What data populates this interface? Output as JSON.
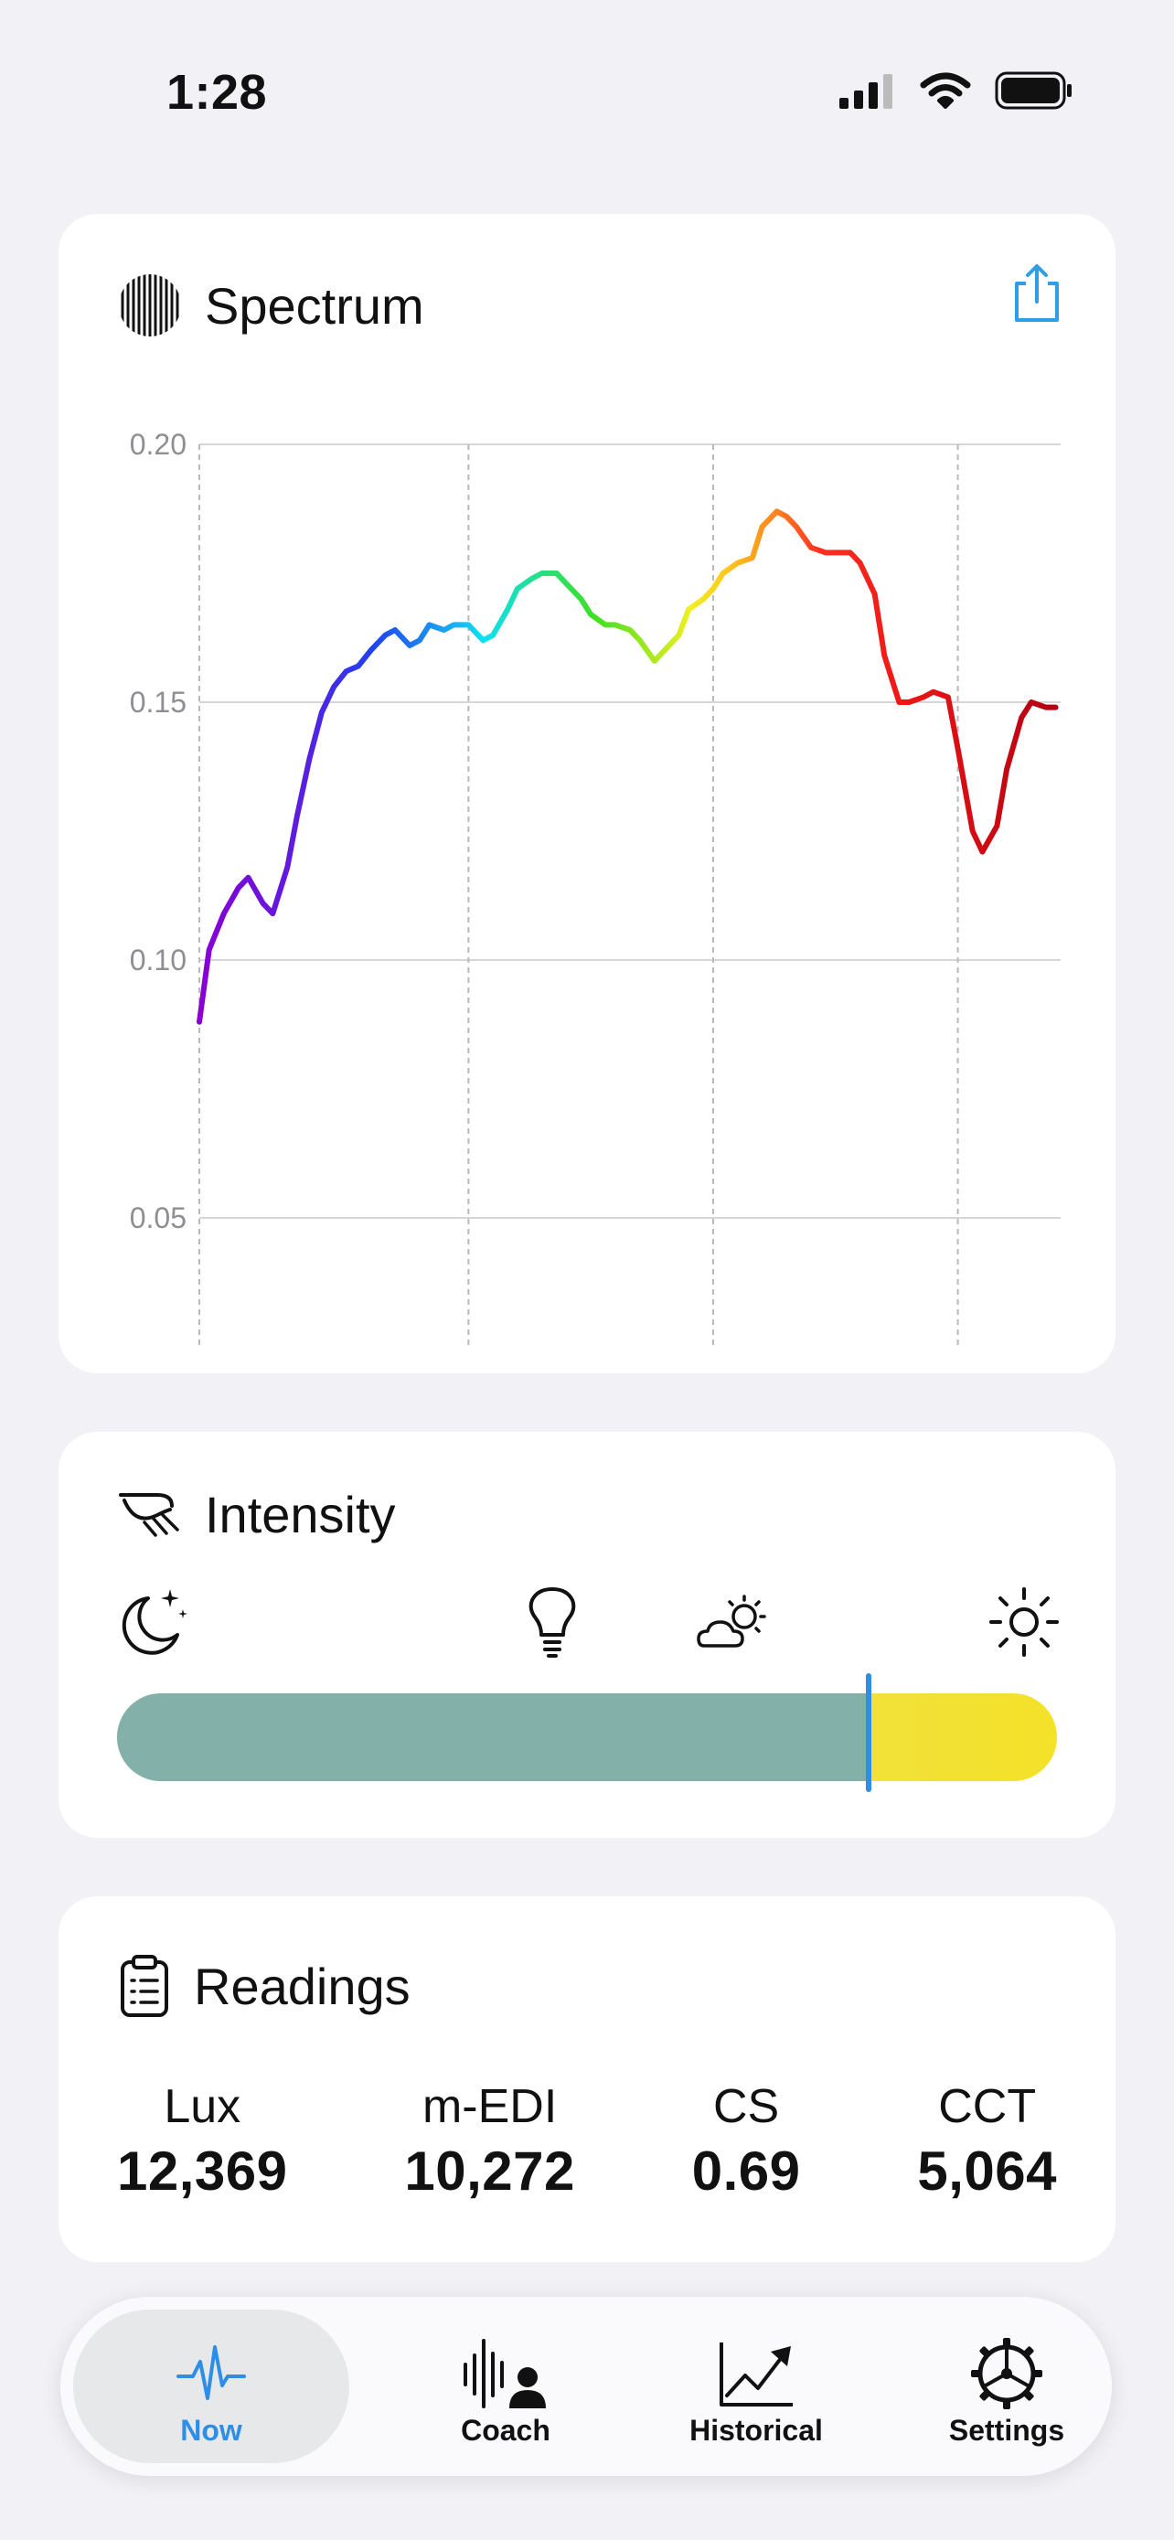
{
  "status_bar": {
    "time": "1:28"
  },
  "spectrum": {
    "title": "Spectrum",
    "icon": "striped-circle-icon",
    "share_icon": "share-icon"
  },
  "chart_data": {
    "type": "line",
    "title": "Spectrum",
    "xlabel": "",
    "ylabel": "",
    "xlim": [
      390,
      742
    ],
    "ylim": [
      0,
      0.2
    ],
    "x_ticks": [
      "400",
      "500",
      "600",
      "700"
    ],
    "y_ticks": [
      "0",
      "0.05",
      "0.10",
      "0.15",
      "0.20"
    ],
    "grid": true,
    "series": [
      {
        "x": [
          390,
          394,
          400,
          406,
          410,
          416,
          420,
          426,
          430,
          435,
          440,
          445,
          450,
          455,
          460,
          466,
          470,
          476,
          480,
          484,
          490,
          494,
          500,
          506,
          510,
          516,
          520,
          526,
          530,
          536,
          540,
          546,
          550,
          556,
          560,
          566,
          570,
          576,
          580,
          586,
          590,
          596,
          600,
          604,
          610,
          616,
          620,
          626,
          630,
          634,
          640,
          646,
          650,
          656,
          660,
          666,
          670,
          676,
          680,
          686,
          690,
          696,
          700,
          706,
          710,
          716,
          720,
          726,
          730,
          736,
          740
        ],
        "y": [
          0.088,
          0.102,
          0.109,
          0.114,
          0.116,
          0.111,
          0.109,
          0.118,
          0.128,
          0.139,
          0.148,
          0.153,
          0.156,
          0.157,
          0.16,
          0.163,
          0.164,
          0.161,
          0.162,
          0.165,
          0.164,
          0.165,
          0.165,
          0.162,
          0.163,
          0.168,
          0.172,
          0.174,
          0.175,
          0.175,
          0.173,
          0.17,
          0.167,
          0.165,
          0.165,
          0.164,
          0.162,
          0.158,
          0.16,
          0.163,
          0.168,
          0.17,
          0.172,
          0.175,
          0.177,
          0.178,
          0.184,
          0.187,
          0.186,
          0.184,
          0.18,
          0.179,
          0.179,
          0.179,
          0.177,
          0.171,
          0.159,
          0.15,
          0.15,
          0.151,
          0.152,
          0.151,
          0.141,
          0.125,
          0.121,
          0.126,
          0.137,
          0.147,
          0.15,
          0.149,
          0.149
        ]
      }
    ]
  },
  "intensity": {
    "title": "Intensity",
    "icon": "light-beam-icon",
    "level_icons": [
      "moon-stars-icon",
      "lightbulb-icon",
      "partly-cloudy-icon",
      "sun-icon"
    ],
    "level_fraction": 0.8,
    "fill_color": "#83b1a9",
    "marker_color": "#2e8ee6"
  },
  "readings": {
    "title": "Readings",
    "icon": "clipboard-icon",
    "items": [
      {
        "label": "Lux",
        "value": "12,369"
      },
      {
        "label": "m-EDI",
        "value": "10,272"
      },
      {
        "label": "CS",
        "value": "0.69"
      },
      {
        "label": "CCT",
        "value": "5,064"
      }
    ]
  },
  "tabs": [
    {
      "label": "Now",
      "icon": "pulse-icon",
      "active": true
    },
    {
      "label": "Coach",
      "icon": "voice-coach-icon",
      "active": false
    },
    {
      "label": "Historical",
      "icon": "trend-chart-icon",
      "active": false
    },
    {
      "label": "Settings",
      "icon": "gear-icon",
      "active": false
    }
  ],
  "colors": {
    "accent": "#2e8ee6",
    "background": "#f1f1f6"
  }
}
